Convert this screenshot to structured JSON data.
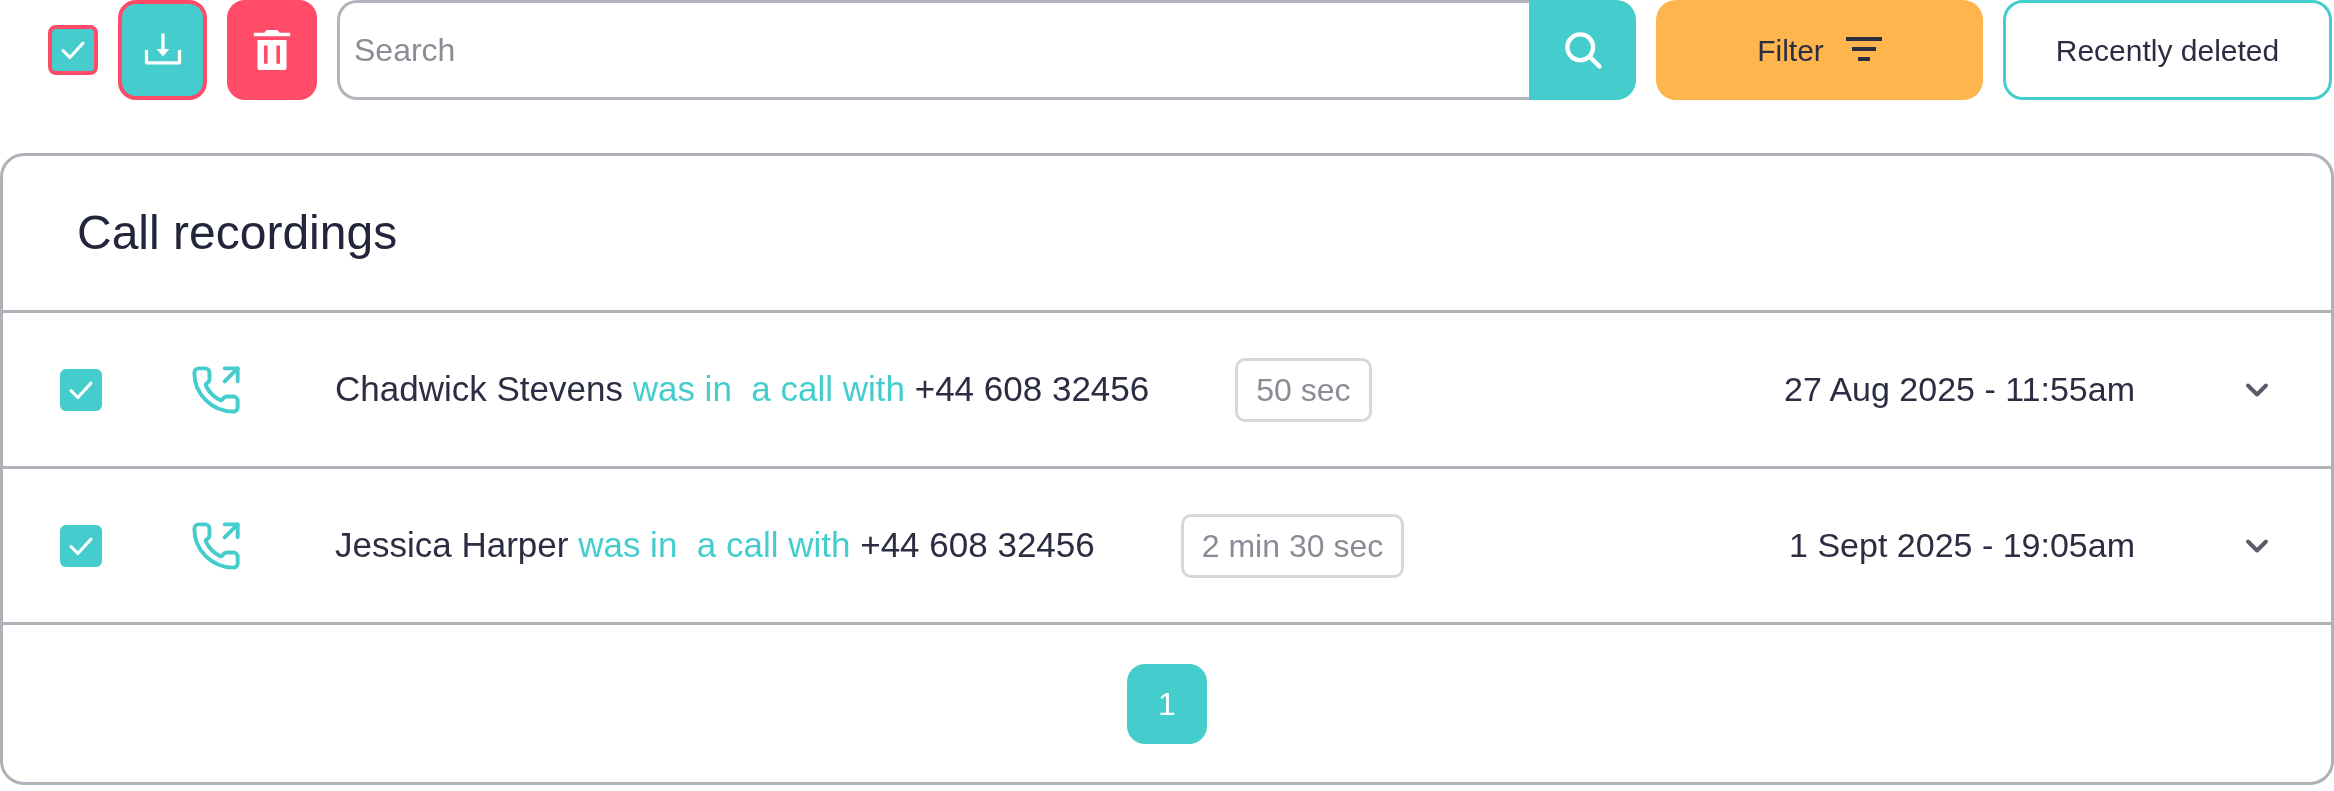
{
  "toolbar": {
    "select_all": {
      "checked": true,
      "highlighted": true
    },
    "download_button": {
      "highlighted": true
    },
    "search": {
      "placeholder": "Search"
    },
    "filter_button": {
      "label": "Filter"
    },
    "recently_deleted_button": {
      "label": "Recently deleted"
    }
  },
  "recordings": {
    "title": "Call recordings",
    "rows": [
      {
        "checked": true,
        "caller": "Chadwick Stevens",
        "action": "was in  a call with",
        "number": "+44 608 32456",
        "duration": "50 sec",
        "datetime": "27 Aug 2025 - 11:55am"
      },
      {
        "checked": true,
        "caller": "Jessica Harper",
        "action": "was in  a call with",
        "number": "+44 608 32456",
        "duration": "2 min 30 sec",
        "datetime": "1 Sept 2025 - 19:05am"
      }
    ]
  },
  "pagination": {
    "pages": [
      {
        "label": "1",
        "selected": true
      }
    ]
  }
}
